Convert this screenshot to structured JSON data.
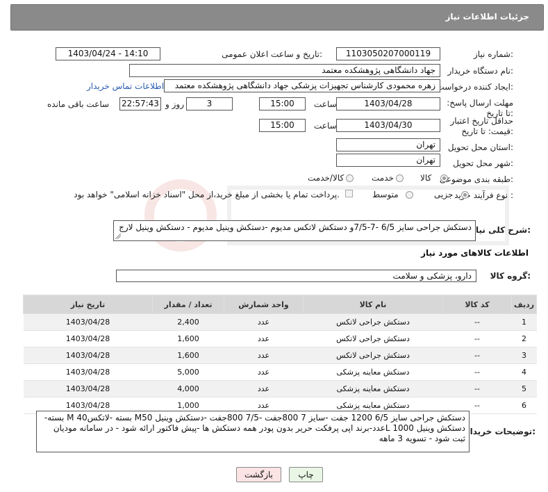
{
  "header": {
    "title": "جزئیات اطلاعات نیاز"
  },
  "fields": {
    "need_number_label": "شماره نیاز:",
    "need_number": "1103050207000119",
    "announce_label": "تاریخ و ساعت اعلان عمومی:",
    "announce_value": "1403/04/24 - 14:10",
    "buyer_org_label": "نام دستگاه خریدار:",
    "buyer_org": "جهاد دانشگاهی پژوهشکده معتمد",
    "creator_label": "ایجاد کننده درخواست:",
    "creator": "زهره محمودی کارشناس تجهیزات پزشکی جهاد دانشگاهی پژوهشکده معتمد",
    "contact_link": "اطلاعات تماس خریدار",
    "reply_deadline_label": "مهلت ارسال پاسخ: تا تاریخ:",
    "reply_date": "1403/04/28",
    "time_label": "ساعت",
    "reply_time": "15:00",
    "days_value": "3",
    "days_label": "روز و",
    "remaining_time": "22:57:43",
    "remaining_label": "ساعت باقی مانده",
    "price_validity_label": "حداقل تاریخ اعتبار قیمت: تا تاریخ:",
    "validity_date": "1403/04/30",
    "validity_time": "15:00",
    "province_label": "استان محل تحویل:",
    "province": "تهران",
    "city_label": "شهر محل تحویل:",
    "city": "تهران",
    "category_label": "طبقه بندی موضوعی:",
    "category_options": [
      "کالا",
      "خدمت",
      "کالا/خدمت"
    ],
    "process_label": "نوع فرآیند خرید :",
    "process_options": [
      "جزیی",
      "متوسط"
    ],
    "payment_note": "پرداخت تمام یا بخشی از مبلغ خرید،از محل \"اسناد خزانه اسلامی\" خواهد بود."
  },
  "description": {
    "label": "شرح کلی نیاز:",
    "text": "دستکش جراحی سایز 6/5 -7-7/5و دستکش لاتکس مدیوم -دستکش وینیل مدیوم - دستکش وینیل لارج"
  },
  "goods_section_title": "اطلاعات کالاهای مورد نیاز",
  "goods_group": {
    "label": "گروه کالا:",
    "value": "دارو، پزشکی و سلامت"
  },
  "table": {
    "columns": [
      "ردیف",
      "کد کالا",
      "نام کالا",
      "واحد شمارش",
      "تعداد / مقدار",
      "تاریخ نیاز"
    ],
    "rows": [
      [
        "1",
        "--",
        "دستکش جراحی لاتکس",
        "عدد",
        "2,400",
        "1403/04/28"
      ],
      [
        "2",
        "--",
        "دستکش جراحی لاتکس",
        "عدد",
        "1,600",
        "1403/04/28"
      ],
      [
        "3",
        "--",
        "دستکش جراحی لاتکس",
        "عدد",
        "1,600",
        "1403/04/28"
      ],
      [
        "4",
        "--",
        "دستکش معاینه پزشکی",
        "عدد",
        "5,000",
        "1403/04/28"
      ],
      [
        "5",
        "--",
        "دستکش معاینه پزشکی",
        "عدد",
        "4,000",
        "1403/04/28"
      ],
      [
        "6",
        "--",
        "دستکش معاینه پزشکی",
        "عدد",
        "1,000",
        "1403/04/28"
      ]
    ]
  },
  "buyer_notes": {
    "label": "توضیحات خریدار:",
    "text": "دستکش جراحی سایز 6/5 1200 جفت -سایز 7 800جفت -7/5 800جفت -دستکش وینیل M50 بسته -لاتکس40 M بسته-دستکش وینیل 1000 Lعدد-برند اپی پرفکت حریر بدون پودر همه دستکش ها -پیش فاکتور ارائه شود - در سامانه مودیان ثبت شود - تسویه 3 ماهه"
  },
  "buttons": {
    "print": "چاپ",
    "back": "بازگشت"
  },
  "colors": {
    "header_bg": "#8a8a8a",
    "table_header": "#d7d7d7",
    "back_btn": "#fde4e4",
    "print_btn": "#e9f6e5"
  }
}
